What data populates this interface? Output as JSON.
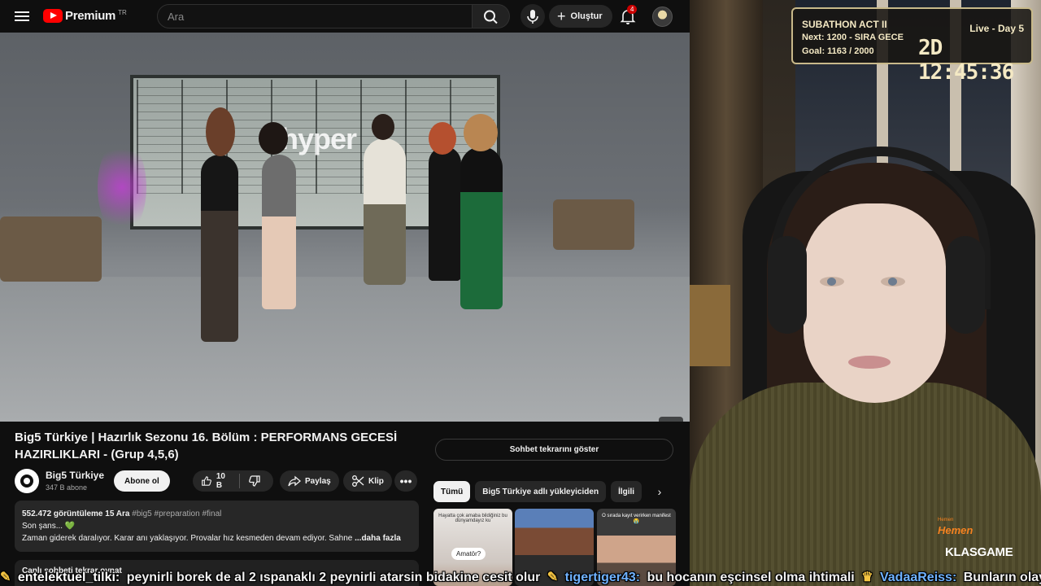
{
  "header": {
    "logo_text": "Premium",
    "logo_region": "TR",
    "search_placeholder": "Ara",
    "create_label": "Oluştur",
    "notification_count": "4"
  },
  "video": {
    "overlay_text": "hyper",
    "title": "Big5 Türkiye | Hazırlık Sezonu 16. Bölüm : PERFORMANS GECESİ HAZIRLIKLARI - (Grup 4,5,6)",
    "channel": "Big5 Türkiye",
    "subscribers": "347 B abone",
    "subscribe_label": "Abone ol",
    "likes": "10 B",
    "share_label": "Paylaş",
    "clip_label": "Klip",
    "more_label": "•••"
  },
  "description": {
    "views": "552.472 görüntüleme",
    "date": "15 Ara",
    "tags": "#big5 #preparation #final",
    "line1": "Son şans... 💚",
    "line2": "Zaman giderek daralıyor. Karar anı yaklaşıyor. Provalar hız kesmeden devam ediyor. Sahne",
    "more": "...daha fazla"
  },
  "chat_replay": {
    "strip_label": "Canlı sohbeti tekrar oynat",
    "button_label": "Sohbet tekrarını göster"
  },
  "recommendations": {
    "chips": [
      "Tümü",
      "Big5 Türkiye adlı yükleyiciden",
      "İlgili"
    ],
    "active_chip": "Tümü",
    "thumbs": [
      {
        "caption": "Hayatta çok amaba bildiğiniz bu dünyamdayız ku",
        "bubble": "Amatör?"
      },
      {
        "caption": ""
      },
      {
        "caption": "O sırada kayıt verirken manifest 😭"
      }
    ]
  },
  "subathon": {
    "title": "SUBATHON ACT II",
    "status": "Live - Day 5",
    "next": "Next: 1200 - SIRA GECE",
    "goal": "Goal: 1163 / 2000",
    "timer": "2D 12:45:36"
  },
  "sponsor": {
    "small": "Hemen",
    "hemen": "Hemen",
    "brand": "KLASGAME"
  },
  "chat_ticker": [
    {
      "user": "entelektuel_tilki:",
      "message": "peynirli borek de al 2 ıspanaklı 2 peynirli atarsin bidakine cesit olur"
    },
    {
      "user": "tigertiger43:",
      "message": "bu hocanın eşcinsel olma ihtimali"
    },
    {
      "user": "VadaaReiss:",
      "message": "Bunların olayı ne?"
    }
  ],
  "colors": {
    "brand_red": "#ff0000",
    "subathon_border": "#c8b98a",
    "sponsor_orange": "#f58220",
    "username_blue": "#6fb2ff"
  }
}
